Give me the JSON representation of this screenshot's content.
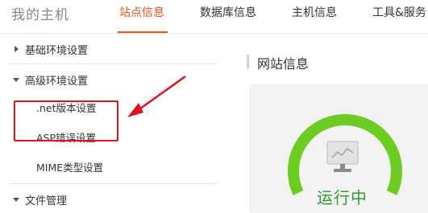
{
  "header": {
    "brand": "我的主机",
    "tabs": [
      {
        "label": "站点信息",
        "active": true
      },
      {
        "label": "数据库信息",
        "active": false
      },
      {
        "label": "主机信息",
        "active": false
      },
      {
        "label": "工具&服务",
        "active": false
      }
    ],
    "accent_color": "#e8541e"
  },
  "sidebar": {
    "items": [
      {
        "label": "基础环境设置",
        "expanded": false
      },
      {
        "label": "高级环境设置",
        "expanded": true,
        "children": [
          ".net版本设置",
          "ASP错误设置",
          "MIME类型设置"
        ]
      },
      {
        "label": "文件管理",
        "expanded": true
      }
    ]
  },
  "main": {
    "section_title": "网站信息",
    "status": {
      "label": "运行中",
      "color": "#6dcc22",
      "icon": "monitor-icon"
    }
  },
  "annotation": {
    "box_color": "#e0101e",
    "arrow_color": "#e0101e"
  }
}
